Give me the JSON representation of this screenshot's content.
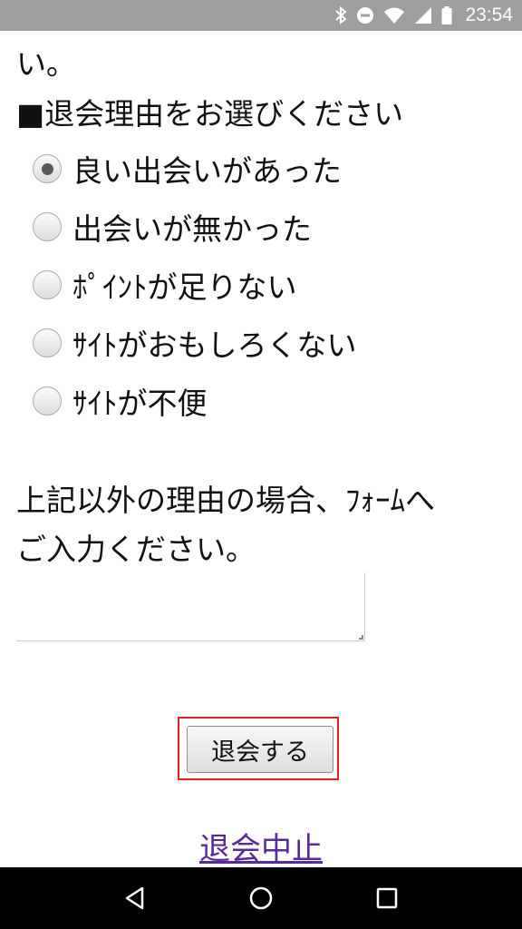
{
  "status_bar": {
    "time": "23:54",
    "icons": [
      "bluetooth-icon",
      "do-not-disturb-icon",
      "wifi-icon",
      "signal-icon",
      "battery-icon"
    ]
  },
  "page": {
    "intro_tail": "い。",
    "section_heading": "■退会理由をお選びください",
    "reasons": [
      {
        "label": "良い出会いがあった",
        "checked": true
      },
      {
        "label": "出会いが無かった",
        "checked": false
      },
      {
        "label": "ﾎﾟｲﾝﾄが足りない",
        "checked": false
      },
      {
        "label": "ｻｲﾄがおもしろくない",
        "checked": false
      },
      {
        "label": "ｻｲﾄが不便",
        "checked": false
      }
    ],
    "other_reason_line1": "上記以外の理由の場合、ﾌｫｰﾑへ",
    "other_reason_line2": "ご入力ください。",
    "textarea_value": "",
    "submit_label": "退会する",
    "cancel_label": "退会中止"
  },
  "colors": {
    "status_bar_bg": "#9e9e9e",
    "link": "#5b2a9a",
    "highlight_border": "#e02020",
    "nav_bar_bg": "#000000"
  },
  "nav_bar": {
    "icons": [
      "back-icon",
      "home-icon",
      "recents-icon"
    ]
  }
}
